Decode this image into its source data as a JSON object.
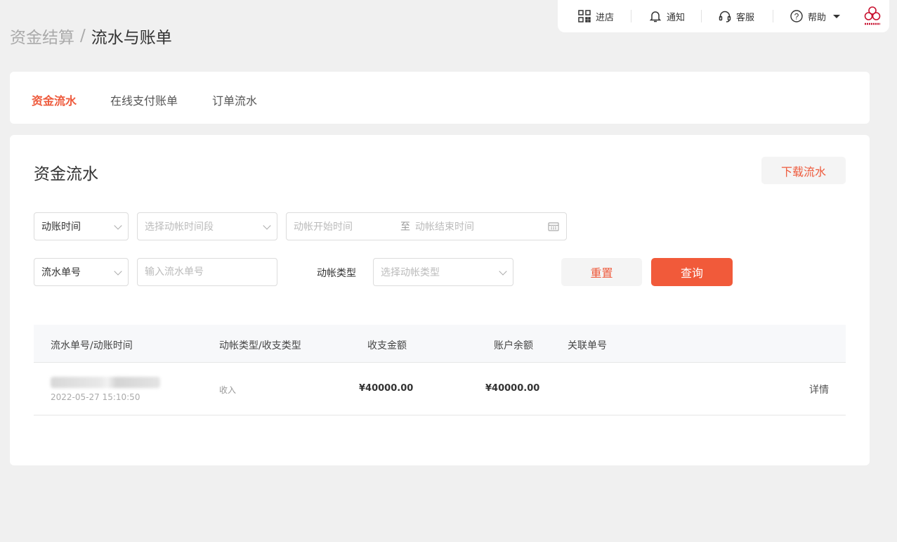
{
  "topbar": {
    "store": "进店",
    "notify": "通知",
    "service": "客服",
    "help": "帮助"
  },
  "breadcrumb": {
    "parent": "资金结算",
    "separator": "/",
    "current": "流水与账单"
  },
  "tabs": [
    {
      "label": "资金流水",
      "active": true
    },
    {
      "label": "在线支付账单",
      "active": false
    },
    {
      "label": "订单流水",
      "active": false
    }
  ],
  "section": {
    "title": "资金流水",
    "download": "下载流水"
  },
  "filters": {
    "time_type": "动账时间",
    "time_range_placeholder": "选择动帐时间段",
    "start_placeholder": "动帐开始时间",
    "range_sep": "至",
    "end_placeholder": "动帐结束时间",
    "id_type": "流水单号",
    "id_placeholder": "输入流水单号",
    "type_label": "动帐类型",
    "type_placeholder": "选择动帐类型",
    "reset": "重置",
    "query": "查询"
  },
  "table": {
    "columns": [
      "流水单号/动账时间",
      "动帐类型/收支类型",
      "收支金额",
      "账户余额",
      "关联单号"
    ],
    "rows": [
      {
        "time": "2022-05-27 15:10:50",
        "type": "收入",
        "amount": "¥40000.00",
        "balance": "¥40000.00",
        "related": "",
        "action": "详情"
      }
    ]
  },
  "colors": {
    "accent": "#ee5a3c",
    "primary_button": "#f15a3a",
    "background": "#f0f0f0"
  }
}
